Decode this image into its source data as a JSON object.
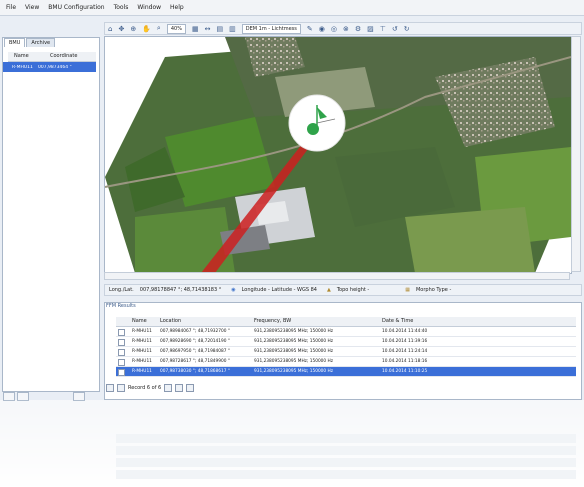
{
  "menu": [
    "File",
    "View",
    "BMU Configuration",
    "Tools",
    "Window",
    "Help"
  ],
  "left_panel": {
    "tabs": [
      "BMU",
      "Archive"
    ],
    "columns": [
      "Name",
      "Coordinate"
    ],
    "rows": [
      {
        "name": "R-MHU11",
        "coordinate": "007,9873464 °"
      }
    ]
  },
  "toolbar": {
    "zoom": "40%",
    "layer": "DEM 1m - Lichtmess"
  },
  "status": {
    "longlat_label": "Long./Lat.",
    "longlat_value": "007,98178847 °; 48,71438183 °",
    "projection": "Longitude - Latitude - WGS 84",
    "topo": "Topo height -",
    "morpho": "Morpho Type -"
  },
  "results": {
    "title": "FFM Results",
    "columns": [
      "",
      "Name",
      "Location",
      "Frequency, BW",
      "Date & Time"
    ],
    "rows": [
      {
        "name": "R-MHU11",
        "location": "007,98984067 °; 48,71932700 °",
        "frequency": "931,238095238095 MHz; 150000 Hz",
        "datetime": "10.04.2014 11:44:40"
      },
      {
        "name": "R-MHU11",
        "location": "007,98928690 °; 48,72014190 °",
        "frequency": "931,238095238095 MHz; 150000 Hz",
        "datetime": "10.04.2014 11:39:16"
      },
      {
        "name": "R-MHU11",
        "location": "007,98697950 °; 48,71984087 °",
        "frequency": "931,238095238095 MHz; 150000 Hz",
        "datetime": "10.04.2014 11:24:14"
      },
      {
        "name": "R-MHU11",
        "location": "007,98728617 °; 48,71849900 °",
        "frequency": "931,238095238095 MHz; 150000 Hz",
        "datetime": "10.04.2014 11:18:16"
      },
      {
        "name": "R-MHU11",
        "location": "007,98738030 °; 48,71868617 °",
        "frequency": "931,238095238095 MHz; 150000 Hz",
        "datetime": "10.04.2014 11:10:25"
      }
    ],
    "record_label": "Record 6 of 6"
  },
  "colors": {
    "selection": "#3b6fd8",
    "beam": "#cc2020",
    "field_green": "#5b8a3a"
  }
}
